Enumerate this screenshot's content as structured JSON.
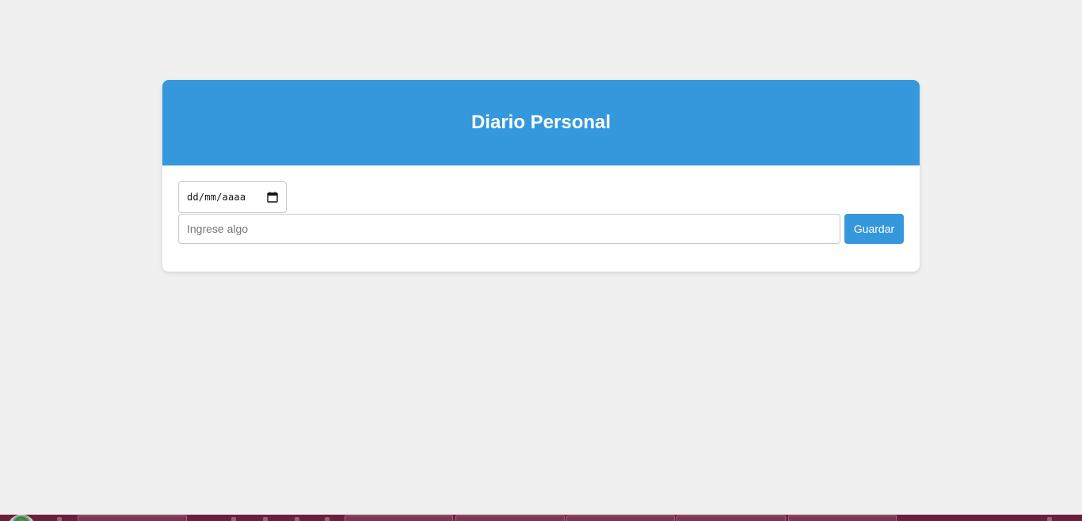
{
  "card": {
    "title": "Diario Personal"
  },
  "form": {
    "date_placeholder": "dd/mm/aaaa",
    "text_placeholder": "Ingrese algo",
    "text_value": "",
    "save_label": "Guardar"
  },
  "colors": {
    "accent": "#3598dc",
    "background": "#f0f0f0",
    "taskbar": "#6b1f3e"
  },
  "icons": {
    "date_picker": "calendar-icon",
    "start": "start-orb-icon"
  }
}
